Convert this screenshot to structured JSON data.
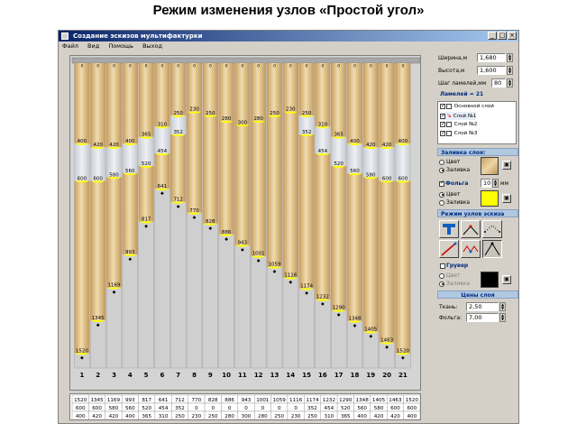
{
  "slide_title": "Режим изменения узлов «Простой угол»",
  "window": {
    "title": "Создание эскизов мультифактурки",
    "buttons": {
      "minimize": "_",
      "maximize": "□",
      "close": "×"
    },
    "menu": [
      "Файл",
      "Вид",
      "Помощь",
      "Выход"
    ]
  },
  "panel": {
    "width_label": "Ширина,м",
    "width_value": "1,680",
    "height_label": "Высота,м",
    "height_value": "1,600",
    "step_label": "Шаг ламелей,мм",
    "step_value": "80",
    "lamels_label": "Ламелей = 21",
    "layers": [
      {
        "name": "Основной слой",
        "checked": true,
        "marker": false
      },
      {
        "name": "Слой №1",
        "checked": true,
        "marker": true
      },
      {
        "name": "Слой №2",
        "checked": true,
        "marker": false
      },
      {
        "name": "Слой №3",
        "checked": true,
        "marker": false
      }
    ],
    "fill_header": "Заливка слоя:",
    "fill_opt_color": "Цвет",
    "fill_opt_fill": "Заливка",
    "foil_label": "Фольга",
    "foil_value": "10",
    "foil_unit": "мм",
    "foil_opt_color": "Цвет",
    "foil_opt_fill": "Заливка",
    "mode_header": "Режим узлов эскиза",
    "gruver_label": "Грувер",
    "gruver_opt_color": "Цвет",
    "gruver_opt_fill": "Заливка",
    "prices_header": "Цены слоя",
    "fabric_label": "Ткань:",
    "fabric_value": "2,50",
    "foil_price_label": "Фольга:",
    "foil_price_value": "7,00",
    "colors": {
      "fill_swatch": "#d8b888",
      "foil_swatch": "#ffff00",
      "gruver_swatch": "#000000"
    }
  },
  "chart_data": {
    "type": "table",
    "lamel_numbers": [
      "1",
      "2",
      "3",
      "4",
      "5",
      "6",
      "7",
      "8",
      "9",
      "10",
      "11",
      "12",
      "13",
      "14",
      "15",
      "16",
      "17",
      "18",
      "19",
      "20",
      "21"
    ],
    "node_bottom": [
      1520,
      1345,
      1169,
      993,
      817,
      641,
      712,
      770,
      828,
      886,
      943,
      1001,
      1059,
      1116,
      1174,
      1232,
      1290,
      1348,
      1405,
      1463,
      1520
    ],
    "node_lower": [
      600,
      600,
      580,
      560,
      520,
      454,
      352,
      0,
      0,
      0,
      0,
      0,
      0,
      0,
      352,
      454,
      520,
      560,
      580,
      600,
      600
    ],
    "node_upper": [
      400,
      420,
      420,
      400,
      365,
      310,
      250,
      230,
      250,
      280,
      300,
      280,
      250,
      230,
      250,
      310,
      365,
      400,
      420,
      420,
      400
    ],
    "table_rows": [
      [
        "1520",
        "1345",
        "1169",
        "993",
        "817",
        "641",
        "712",
        "770",
        "828",
        "886",
        "943",
        "1001",
        "1059",
        "1116",
        "1174",
        "1232",
        "1290",
        "1348",
        "1405",
        "1463",
        "1520"
      ],
      [
        "600",
        "600",
        "580",
        "560",
        "520",
        "454",
        "352",
        "0",
        "0",
        "0",
        "0",
        "0",
        "0",
        "0",
        "352",
        "454",
        "520",
        "560",
        "580",
        "600",
        "600"
      ],
      [
        "400",
        "420",
        "420",
        "400",
        "365",
        "310",
        "250",
        "230",
        "250",
        "280",
        "300",
        "280",
        "250",
        "230",
        "250",
        "310",
        "365",
        "400",
        "420",
        "420",
        "400"
      ]
    ],
    "top_labels": [
      "0",
      "0",
      "0",
      "0",
      "0",
      "0",
      "0",
      "0",
      "0",
      "0",
      "0",
      "0",
      "0",
      "0",
      "0",
      "0",
      "0",
      "0",
      "0",
      "0",
      "0"
    ],
    "colors": {
      "fabric": "#d6b27a",
      "fabric_light": "#ecd7a8",
      "foil": "#ffff00",
      "band": "#d6dae0",
      "background": "#d4d4d4"
    }
  }
}
